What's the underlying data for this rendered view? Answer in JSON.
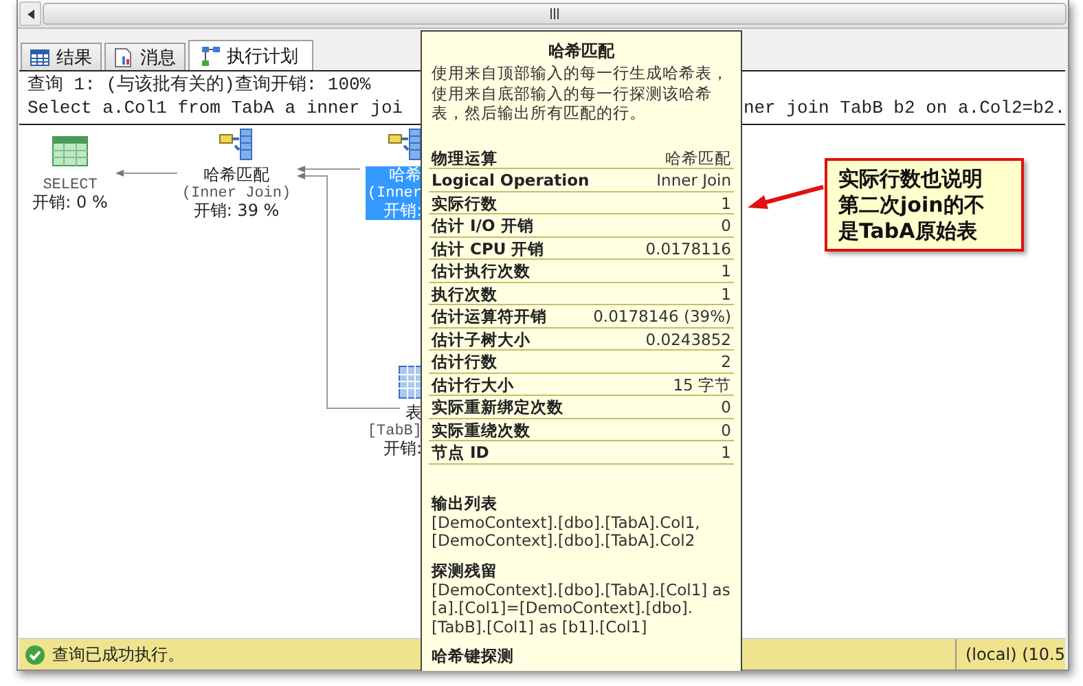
{
  "tabs": [
    {
      "label": "结果",
      "kind": "grid",
      "selected": false
    },
    {
      "label": "消息",
      "kind": "doc",
      "selected": false
    },
    {
      "label": "执行计划",
      "kind": "plan",
      "selected": true
    }
  ],
  "query": {
    "header": "查询 1: (与该批有关的)查询开销: 100%",
    "sql_visible_left": "Select a.Col1 from TabA a inner joi",
    "sql_visible_right": "ner join TabB b2 on a.Col2=b2."
  },
  "plan_nodes": [
    {
      "kind": "select",
      "name": "SELECT",
      "cost": "开销: 0 %",
      "selected": false
    },
    {
      "kind": "hash_match",
      "name": "哈希匹配",
      "detail": "(Inner Join)",
      "cost": "开销: 39 %",
      "selected": false
    },
    {
      "kind": "hash_match",
      "name": "哈希",
      "detail": "(Inner",
      "cost": "开销:",
      "selected": true
    },
    {
      "kind": "table_scan",
      "name": "表",
      "detail": "[TabB]",
      "cost": "开销:",
      "selected": false
    }
  ],
  "tooltip": {
    "title": "哈希匹配",
    "description": "使用来自顶部输入的每一行生成哈希表，使用来自底部输入的每一行探测该哈希表，然后输出所有匹配的行。",
    "properties": [
      {
        "label": "物理运算",
        "value": "哈希匹配"
      },
      {
        "label": "Logical Operation",
        "value": "Inner Join"
      },
      {
        "label": "实际行数",
        "value": "1"
      },
      {
        "label": "估计 I/O 开销",
        "value": "0"
      },
      {
        "label": "估计 CPU 开销",
        "value": "0.0178116"
      },
      {
        "label": "估计执行次数",
        "value": "1"
      },
      {
        "label": "执行次数",
        "value": "1"
      },
      {
        "label": "估计运算符开销",
        "value": "0.0178146 (39%)"
      },
      {
        "label": "估计子树大小",
        "value": "0.0243852"
      },
      {
        "label": "估计行数",
        "value": "2"
      },
      {
        "label": "估计行大小",
        "value": "15 字节"
      },
      {
        "label": "实际重新绑定次数",
        "value": "0"
      },
      {
        "label": "实际重绕次数",
        "value": "0"
      },
      {
        "label": "节点 ID",
        "value": "1"
      }
    ],
    "sections": [
      {
        "heading": "输出列表",
        "text": "[DemoContext].[dbo].[TabA].Col1, [DemoContext].[dbo].[TabA].Col2"
      },
      {
        "heading": "探测残留",
        "text": "[DemoContext].[dbo].[TabA].[Col1] as [a].[Col1]=[DemoContext].[dbo].[TabB].[Col1] as [b1].[Col1]"
      },
      {
        "heading": "哈希键探测"
      }
    ]
  },
  "callout": {
    "lines": [
      "实际行数也说明",
      "第二次join的不",
      "是TabA原始表"
    ]
  },
  "status_bar": {
    "message": "查询已成功执行。",
    "server": "(local) (10.5"
  }
}
